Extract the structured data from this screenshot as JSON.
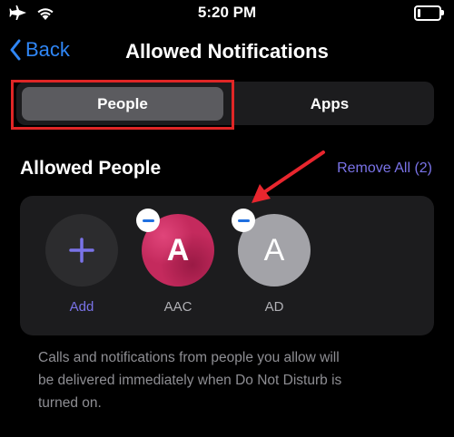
{
  "status_bar": {
    "time": "5:20 PM"
  },
  "nav": {
    "back_label": "Back",
    "title": "Allowed Notifications"
  },
  "segmented": {
    "people_label": "People",
    "apps_label": "Apps",
    "selected": "People"
  },
  "section": {
    "title": "Allowed People",
    "remove_all_label": "Remove All (2)"
  },
  "people": [
    {
      "label": "Add",
      "icon": "plus-icon"
    },
    {
      "label": "AAC",
      "initial": "A"
    },
    {
      "label": "AD",
      "initial": "A"
    }
  ],
  "footer": {
    "lines": [
      "Calls and notifications from people you allow will",
      "be delivered immediately when Do Not Disturb is",
      "turned on."
    ]
  },
  "colors": {
    "accent_blue": "#2f86f6",
    "accent_purple": "#7a73e8",
    "highlight_red": "#e02626",
    "arrow_red": "#e8262e"
  }
}
